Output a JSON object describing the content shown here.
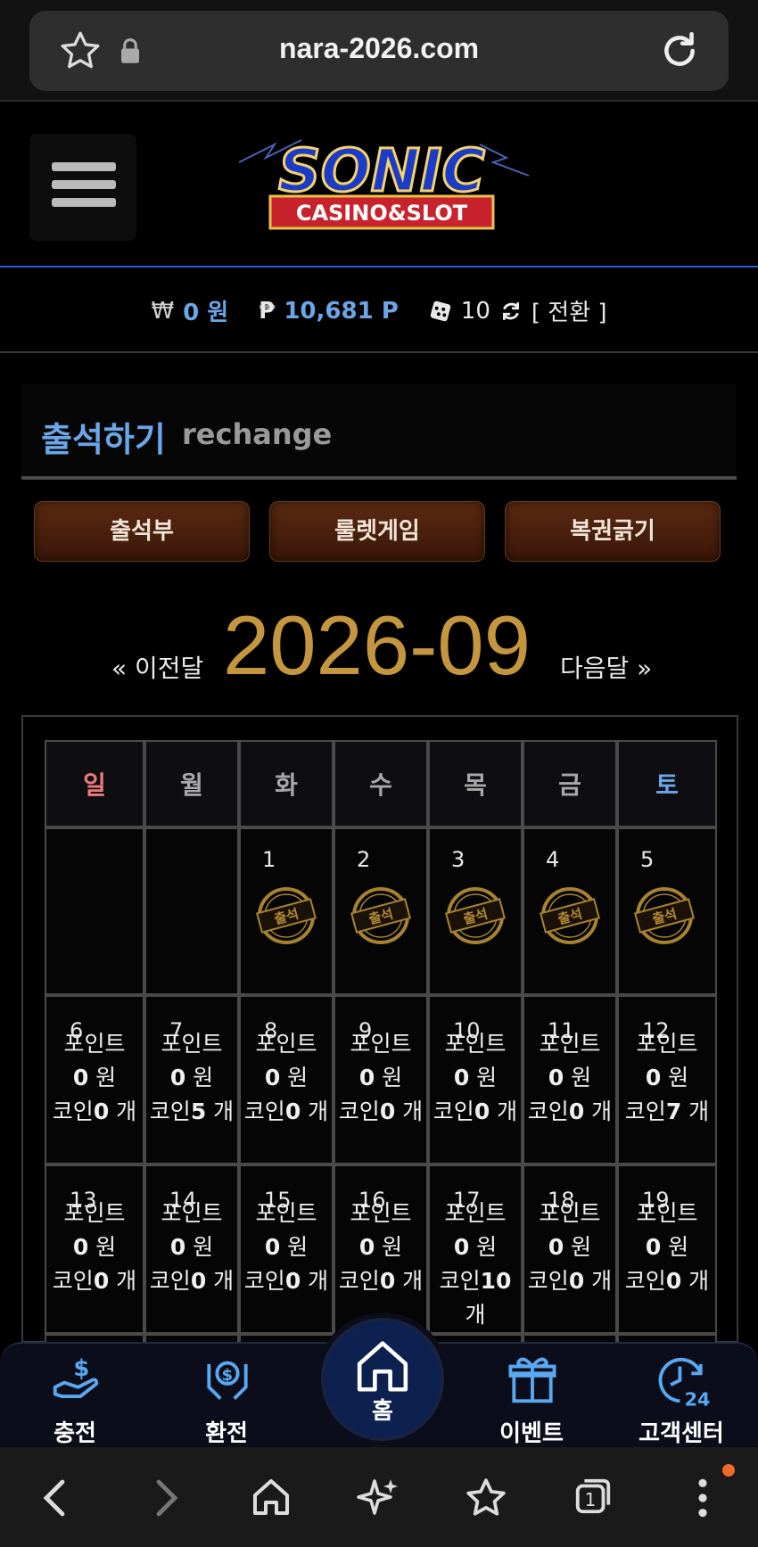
{
  "browser": {
    "url": "nara-2026.com",
    "tab_count": "1"
  },
  "site": {
    "logo_main": "SONIC",
    "logo_sub": "CASINO&SLOT"
  },
  "balance": {
    "won_symbol": "₩",
    "won_value": "0 원",
    "point_symbol": "₱",
    "point_value": "10,681 P",
    "dice_value": "10",
    "switch_label": "[ 전환 ]"
  },
  "section": {
    "title_ko": "출석하기",
    "title_en": "rechange"
  },
  "tabs": [
    {
      "label": "출석부"
    },
    {
      "label": "룰렛게임"
    },
    {
      "label": "복권긁기"
    }
  ],
  "calendar": {
    "prev_label": "« 이전달",
    "month": "2026-09",
    "next_label": "다음달 »",
    "weekdays": [
      "일",
      "월",
      "화",
      "수",
      "목",
      "금",
      "토"
    ],
    "stamp_label": "출석",
    "week1": [
      {
        "day": ""
      },
      {
        "day": ""
      },
      {
        "day": "1"
      },
      {
        "day": "2"
      },
      {
        "day": "3"
      },
      {
        "day": "4"
      },
      {
        "day": "5"
      }
    ],
    "point_label": "포인트",
    "won_unit": "원",
    "coin_label": "코인",
    "coin_unit": "개",
    "week2": [
      {
        "day": "6",
        "points": "0",
        "coins": "0"
      },
      {
        "day": "7",
        "points": "0",
        "coins": "5"
      },
      {
        "day": "8",
        "points": "0",
        "coins": "0"
      },
      {
        "day": "9",
        "points": "0",
        "coins": "0"
      },
      {
        "day": "10",
        "points": "0",
        "coins": "0"
      },
      {
        "day": "11",
        "points": "0",
        "coins": "0"
      },
      {
        "day": "12",
        "points": "0",
        "coins": "7"
      }
    ],
    "week3": [
      {
        "day": "13",
        "points": "0",
        "coins": "0"
      },
      {
        "day": "14",
        "points": "0",
        "coins": "0"
      },
      {
        "day": "15",
        "points": "0",
        "coins": "0"
      },
      {
        "day": "16",
        "points": "0",
        "coins": "0"
      },
      {
        "day": "17",
        "points": "0",
        "coins": "10"
      },
      {
        "day": "18",
        "points": "0",
        "coins": "0"
      },
      {
        "day": "19",
        "points": "0",
        "coins": "0"
      }
    ]
  },
  "bottom_nav": {
    "charge": "충전",
    "exchange": "환전",
    "home": "홈",
    "event": "이벤트",
    "support": "고객센터"
  },
  "colors": {
    "accent_blue": "#6aa6e8",
    "gold": "#c4963e",
    "sunday_red": "#ee7a7a",
    "tab_brown": "#4a2010"
  }
}
